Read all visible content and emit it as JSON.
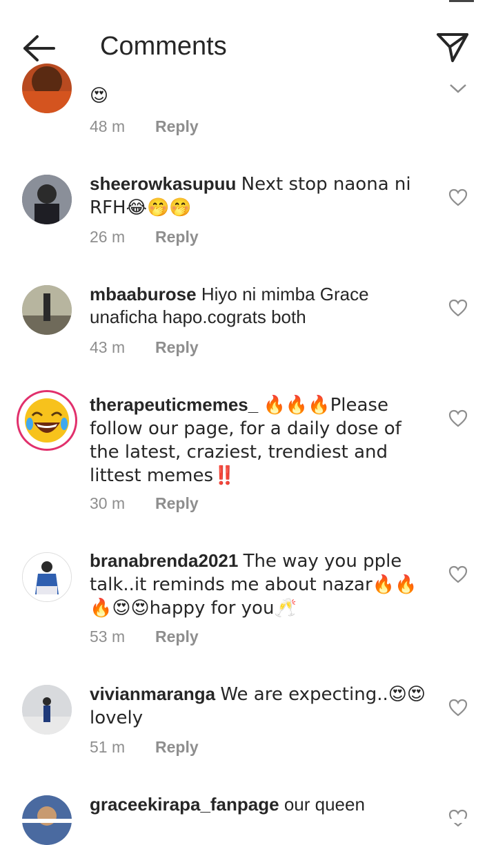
{
  "header": {
    "title": "Comments"
  },
  "comments": [
    {
      "username": "",
      "text": "😍",
      "time": "48 m",
      "reply": "Reply"
    },
    {
      "username": "sheerowkasupuu",
      "text": "Next stop naona ni RFH😂🤭🤭",
      "time": "26 m",
      "reply": "Reply"
    },
    {
      "username": "mbaaburose",
      "text": "Hiyo ni mimba Grace unaficha hapo.cograts both",
      "time": "43 m",
      "reply": "Reply"
    },
    {
      "username": "therapeuticmemes_",
      "text": "🔥🔥🔥Please follow our page, for a daily dose of the latest, craziest, trendiest and littest memes‼️",
      "time": "30 m",
      "reply": "Reply"
    },
    {
      "username": "branabrenda2021",
      "text": "The way you pple talk..it reminds  me about nazar🔥🔥🔥😍😍happy  for  you🥂",
      "time": "53 m",
      "reply": "Reply"
    },
    {
      "username": "vivianmaranga",
      "text": "We are expecting..😍😍 lovely",
      "time": "51 m",
      "reply": "Reply"
    },
    {
      "username": "graceekirapa_fanpage",
      "text": "our queen",
      "time": "",
      "reply": ""
    }
  ],
  "icons": {
    "back": "arrow-left-icon",
    "send": "paper-plane-icon",
    "like": "heart-outline-icon",
    "collapse": "chevron-down-icon"
  },
  "colors": {
    "text": "#262626",
    "meta": "#8e8e8e",
    "story_ring": "#e1306c"
  }
}
